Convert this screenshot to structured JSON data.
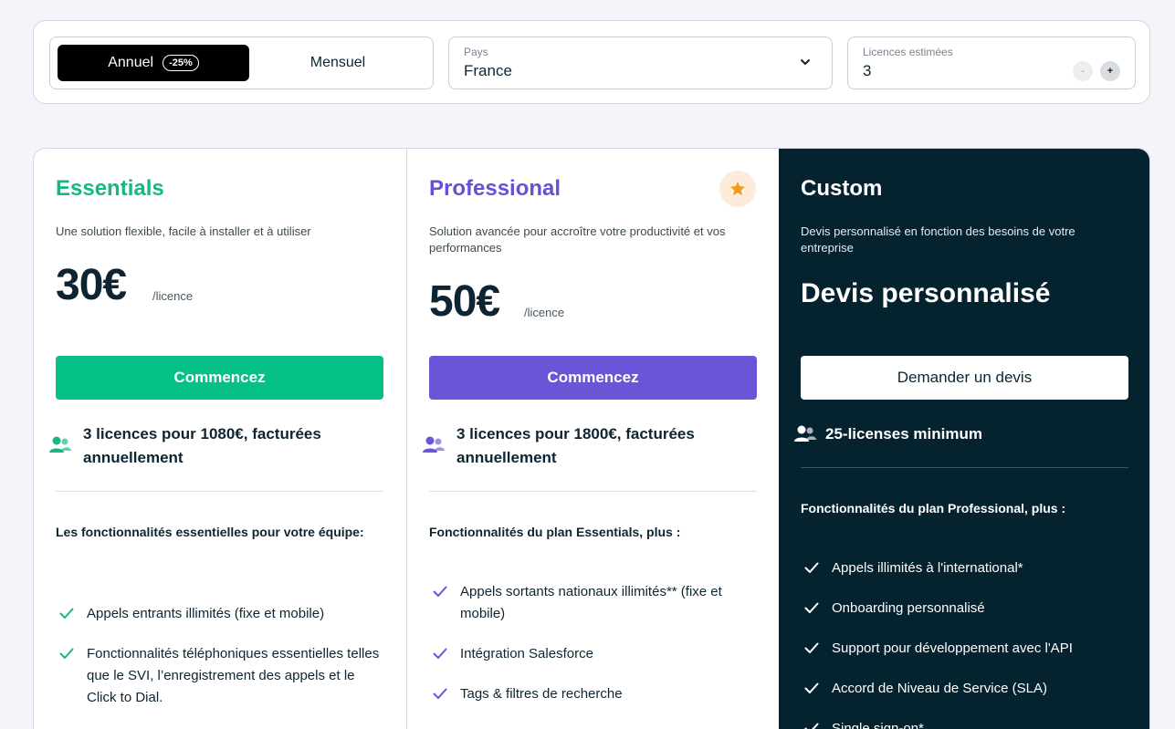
{
  "filters": {
    "billing": {
      "annual_label": "Annuel",
      "annual_discount": "-25%",
      "monthly_label": "Mensuel"
    },
    "country": {
      "label": "Pays",
      "value": "France"
    },
    "licenses": {
      "label": "Licences estimées",
      "value": "3",
      "minus": "-",
      "plus": "+"
    }
  },
  "plans": {
    "essentials": {
      "name": "Essentials",
      "description": "Une solution flexible, facile à installer et à utiliser",
      "price": "30€",
      "price_unit": "/licence",
      "cta": "Commencez",
      "licence_info": "3 licences pour 1080€, facturées annuellement",
      "features_heading": "Les fonctionnalités essentielles pour votre équipe:",
      "features": [
        "Appels entrants illimités (fixe et mobile)",
        "Fonctionnalités téléphoniques essentielles telles que le SVI, l’enregistrement des appels et le Click to Dial."
      ]
    },
    "professional": {
      "name": "Professional",
      "description": "Solution avancée pour accroître votre productivité et vos performances",
      "price": "50€",
      "price_unit": "/licence",
      "cta": "Commencez",
      "licence_info": "3 licences pour 1800€, facturées annuellement",
      "features_heading": "Fonctionnalités du plan Essentials, plus :",
      "features": [
        "Appels sortants nationaux illimités** (fixe et mobile)",
        "Intégration Salesforce",
        "Tags & filtres de recherche"
      ]
    },
    "custom": {
      "name": "Custom",
      "description": "Devis personnalisé en fonction des besoins de votre entreprise",
      "price_text": "Devis personnalisé",
      "cta": "Demander un devis",
      "licence_info": "25-licenses minimum",
      "features_heading": "Fonctionnalités du plan Professional, plus :",
      "features": [
        "Appels illimités à l'international*",
        "Onboarding personnalisé",
        "Support pour développement avec l'API",
        "Accord de Niveau de Service (SLA)",
        "Single sign-on*"
      ]
    }
  },
  "colors": {
    "essentials": "#05c087",
    "professional": "#6a55d9",
    "custom_bg": "#05222f",
    "star": "#f29a1c"
  },
  "icons": {
    "country_dropdown": "chevron-down-icon",
    "licence_users": "users-icon",
    "feature_check": "check-icon",
    "featured": "star-icon"
  }
}
